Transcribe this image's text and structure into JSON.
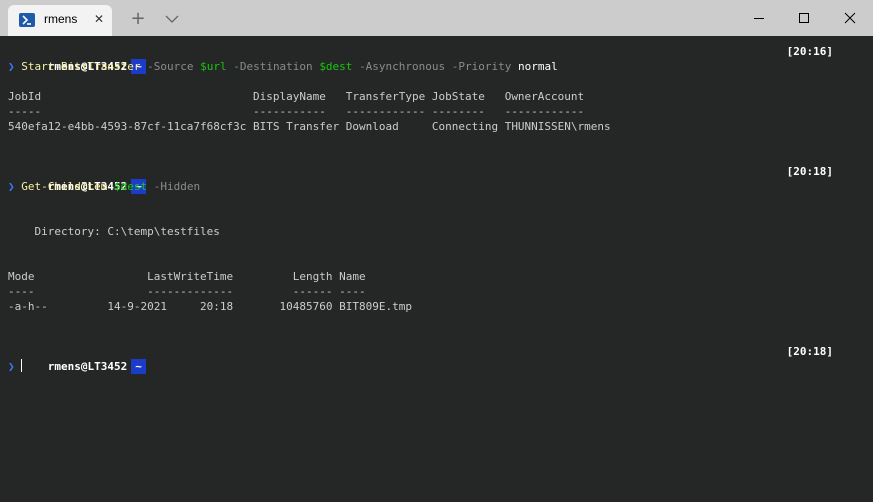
{
  "window": {
    "tab_title": "rmens",
    "tab_icon": "powershell-icon",
    "new_tab_symbol": "+",
    "close_symbol": "✕"
  },
  "colors": {
    "background": "#252727",
    "titlebar": "#cccccc",
    "command": "#f9f1a5",
    "variable": "#16c60c",
    "parameter": "#8a8a8a",
    "chevron": "#3b78ff",
    "prompt_segment": "#1b3cc9"
  },
  "prompts": [
    {
      "user": "rmens@LT3452",
      "path": "~",
      "time": "[20:16]"
    },
    {
      "user": "rmens@LT3452",
      "path": "~",
      "time": "[20:18]"
    },
    {
      "user": "rmens@LT3452",
      "path": "~",
      "time": "[20:18]"
    }
  ],
  "commands": {
    "c1": {
      "chevron": "❯",
      "name": "Start-BitsTransfer",
      "p1": "-Source",
      "v1": "$url",
      "p2": "-Destination",
      "v2": "$dest",
      "p3": "-Asynchronous",
      "p4": "-Priority",
      "arg": "normal"
    },
    "c2": {
      "chevron": "❯",
      "name": "Get-ChildItem",
      "v1": "$dest",
      "p1": "-Hidden"
    },
    "c3": {
      "chevron": "❯"
    }
  },
  "output1": {
    "header": "JobId                                DisplayName   TransferType JobState   OwnerAccount",
    "underline": "-----                                -----------   ------------ --------   ------------",
    "row": "540efa12-e4bb-4593-87cf-11ca7f68cf3c BITS Transfer Download     Connecting THUNNISSEN\\rmens"
  },
  "output2": {
    "directory": "    Directory: C:\\temp\\testfiles",
    "header": "Mode                 LastWriteTime         Length Name",
    "underline": "----                 -------------         ------ ----",
    "row": "-a-h--         14-9-2021     20:18       10485760 BIT809E.tmp"
  }
}
